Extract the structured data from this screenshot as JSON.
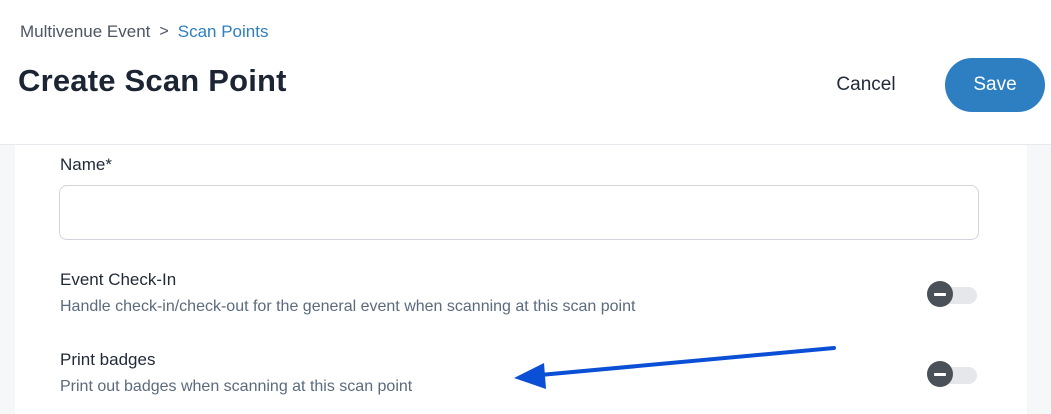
{
  "breadcrumb": {
    "parent": "Multivenue Event",
    "separator": ">",
    "current": "Scan Points"
  },
  "page": {
    "title": "Create Scan Point"
  },
  "actions": {
    "cancel_label": "Cancel",
    "save_label": "Save"
  },
  "form": {
    "name_label": "Name*",
    "name_value": "",
    "settings": [
      {
        "title": "Event Check-In",
        "description": "Handle check-in/check-out for the general event when scanning at this scan point",
        "enabled": false
      },
      {
        "title": "Print badges",
        "description": "Print out badges when scanning at this scan point",
        "enabled": false
      }
    ]
  },
  "annotation": {
    "arrow_color": "#0b4fd6",
    "icon": "arrow-left-annotation"
  },
  "colors": {
    "accent": "#2d7fc1",
    "toggle_off_knob": "#4b5158",
    "toggle_off_track": "#e5e7eb"
  }
}
